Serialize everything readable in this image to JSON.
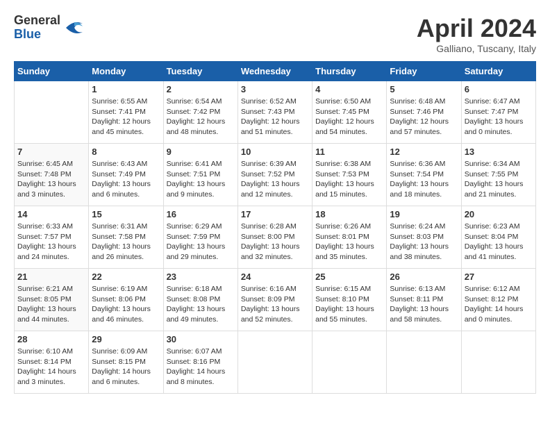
{
  "header": {
    "logo_general": "General",
    "logo_blue": "Blue",
    "month_year": "April 2024",
    "location": "Galliano, Tuscany, Italy"
  },
  "days_of_week": [
    "Sunday",
    "Monday",
    "Tuesday",
    "Wednesday",
    "Thursday",
    "Friday",
    "Saturday"
  ],
  "weeks": [
    [
      {
        "day": "",
        "sunrise": "",
        "sunset": "",
        "daylight": ""
      },
      {
        "day": "1",
        "sunrise": "Sunrise: 6:55 AM",
        "sunset": "Sunset: 7:41 PM",
        "daylight": "Daylight: 12 hours and 45 minutes."
      },
      {
        "day": "2",
        "sunrise": "Sunrise: 6:54 AM",
        "sunset": "Sunset: 7:42 PM",
        "daylight": "Daylight: 12 hours and 48 minutes."
      },
      {
        "day": "3",
        "sunrise": "Sunrise: 6:52 AM",
        "sunset": "Sunset: 7:43 PM",
        "daylight": "Daylight: 12 hours and 51 minutes."
      },
      {
        "day": "4",
        "sunrise": "Sunrise: 6:50 AM",
        "sunset": "Sunset: 7:45 PM",
        "daylight": "Daylight: 12 hours and 54 minutes."
      },
      {
        "day": "5",
        "sunrise": "Sunrise: 6:48 AM",
        "sunset": "Sunset: 7:46 PM",
        "daylight": "Daylight: 12 hours and 57 minutes."
      },
      {
        "day": "6",
        "sunrise": "Sunrise: 6:47 AM",
        "sunset": "Sunset: 7:47 PM",
        "daylight": "Daylight: 13 hours and 0 minutes."
      }
    ],
    [
      {
        "day": "7",
        "sunrise": "Sunrise: 6:45 AM",
        "sunset": "Sunset: 7:48 PM",
        "daylight": "Daylight: 13 hours and 3 minutes."
      },
      {
        "day": "8",
        "sunrise": "Sunrise: 6:43 AM",
        "sunset": "Sunset: 7:49 PM",
        "daylight": "Daylight: 13 hours and 6 minutes."
      },
      {
        "day": "9",
        "sunrise": "Sunrise: 6:41 AM",
        "sunset": "Sunset: 7:51 PM",
        "daylight": "Daylight: 13 hours and 9 minutes."
      },
      {
        "day": "10",
        "sunrise": "Sunrise: 6:39 AM",
        "sunset": "Sunset: 7:52 PM",
        "daylight": "Daylight: 13 hours and 12 minutes."
      },
      {
        "day": "11",
        "sunrise": "Sunrise: 6:38 AM",
        "sunset": "Sunset: 7:53 PM",
        "daylight": "Daylight: 13 hours and 15 minutes."
      },
      {
        "day": "12",
        "sunrise": "Sunrise: 6:36 AM",
        "sunset": "Sunset: 7:54 PM",
        "daylight": "Daylight: 13 hours and 18 minutes."
      },
      {
        "day": "13",
        "sunrise": "Sunrise: 6:34 AM",
        "sunset": "Sunset: 7:55 PM",
        "daylight": "Daylight: 13 hours and 21 minutes."
      }
    ],
    [
      {
        "day": "14",
        "sunrise": "Sunrise: 6:33 AM",
        "sunset": "Sunset: 7:57 PM",
        "daylight": "Daylight: 13 hours and 24 minutes."
      },
      {
        "day": "15",
        "sunrise": "Sunrise: 6:31 AM",
        "sunset": "Sunset: 7:58 PM",
        "daylight": "Daylight: 13 hours and 26 minutes."
      },
      {
        "day": "16",
        "sunrise": "Sunrise: 6:29 AM",
        "sunset": "Sunset: 7:59 PM",
        "daylight": "Daylight: 13 hours and 29 minutes."
      },
      {
        "day": "17",
        "sunrise": "Sunrise: 6:28 AM",
        "sunset": "Sunset: 8:00 PM",
        "daylight": "Daylight: 13 hours and 32 minutes."
      },
      {
        "day": "18",
        "sunrise": "Sunrise: 6:26 AM",
        "sunset": "Sunset: 8:01 PM",
        "daylight": "Daylight: 13 hours and 35 minutes."
      },
      {
        "day": "19",
        "sunrise": "Sunrise: 6:24 AM",
        "sunset": "Sunset: 8:03 PM",
        "daylight": "Daylight: 13 hours and 38 minutes."
      },
      {
        "day": "20",
        "sunrise": "Sunrise: 6:23 AM",
        "sunset": "Sunset: 8:04 PM",
        "daylight": "Daylight: 13 hours and 41 minutes."
      }
    ],
    [
      {
        "day": "21",
        "sunrise": "Sunrise: 6:21 AM",
        "sunset": "Sunset: 8:05 PM",
        "daylight": "Daylight: 13 hours and 44 minutes."
      },
      {
        "day": "22",
        "sunrise": "Sunrise: 6:19 AM",
        "sunset": "Sunset: 8:06 PM",
        "daylight": "Daylight: 13 hours and 46 minutes."
      },
      {
        "day": "23",
        "sunrise": "Sunrise: 6:18 AM",
        "sunset": "Sunset: 8:08 PM",
        "daylight": "Daylight: 13 hours and 49 minutes."
      },
      {
        "day": "24",
        "sunrise": "Sunrise: 6:16 AM",
        "sunset": "Sunset: 8:09 PM",
        "daylight": "Daylight: 13 hours and 52 minutes."
      },
      {
        "day": "25",
        "sunrise": "Sunrise: 6:15 AM",
        "sunset": "Sunset: 8:10 PM",
        "daylight": "Daylight: 13 hours and 55 minutes."
      },
      {
        "day": "26",
        "sunrise": "Sunrise: 6:13 AM",
        "sunset": "Sunset: 8:11 PM",
        "daylight": "Daylight: 13 hours and 58 minutes."
      },
      {
        "day": "27",
        "sunrise": "Sunrise: 6:12 AM",
        "sunset": "Sunset: 8:12 PM",
        "daylight": "Daylight: 14 hours and 0 minutes."
      }
    ],
    [
      {
        "day": "28",
        "sunrise": "Sunrise: 6:10 AM",
        "sunset": "Sunset: 8:14 PM",
        "daylight": "Daylight: 14 hours and 3 minutes."
      },
      {
        "day": "29",
        "sunrise": "Sunrise: 6:09 AM",
        "sunset": "Sunset: 8:15 PM",
        "daylight": "Daylight: 14 hours and 6 minutes."
      },
      {
        "day": "30",
        "sunrise": "Sunrise: 6:07 AM",
        "sunset": "Sunset: 8:16 PM",
        "daylight": "Daylight: 14 hours and 8 minutes."
      },
      {
        "day": "",
        "sunrise": "",
        "sunset": "",
        "daylight": ""
      },
      {
        "day": "",
        "sunrise": "",
        "sunset": "",
        "daylight": ""
      },
      {
        "day": "",
        "sunrise": "",
        "sunset": "",
        "daylight": ""
      },
      {
        "day": "",
        "sunrise": "",
        "sunset": "",
        "daylight": ""
      }
    ]
  ]
}
